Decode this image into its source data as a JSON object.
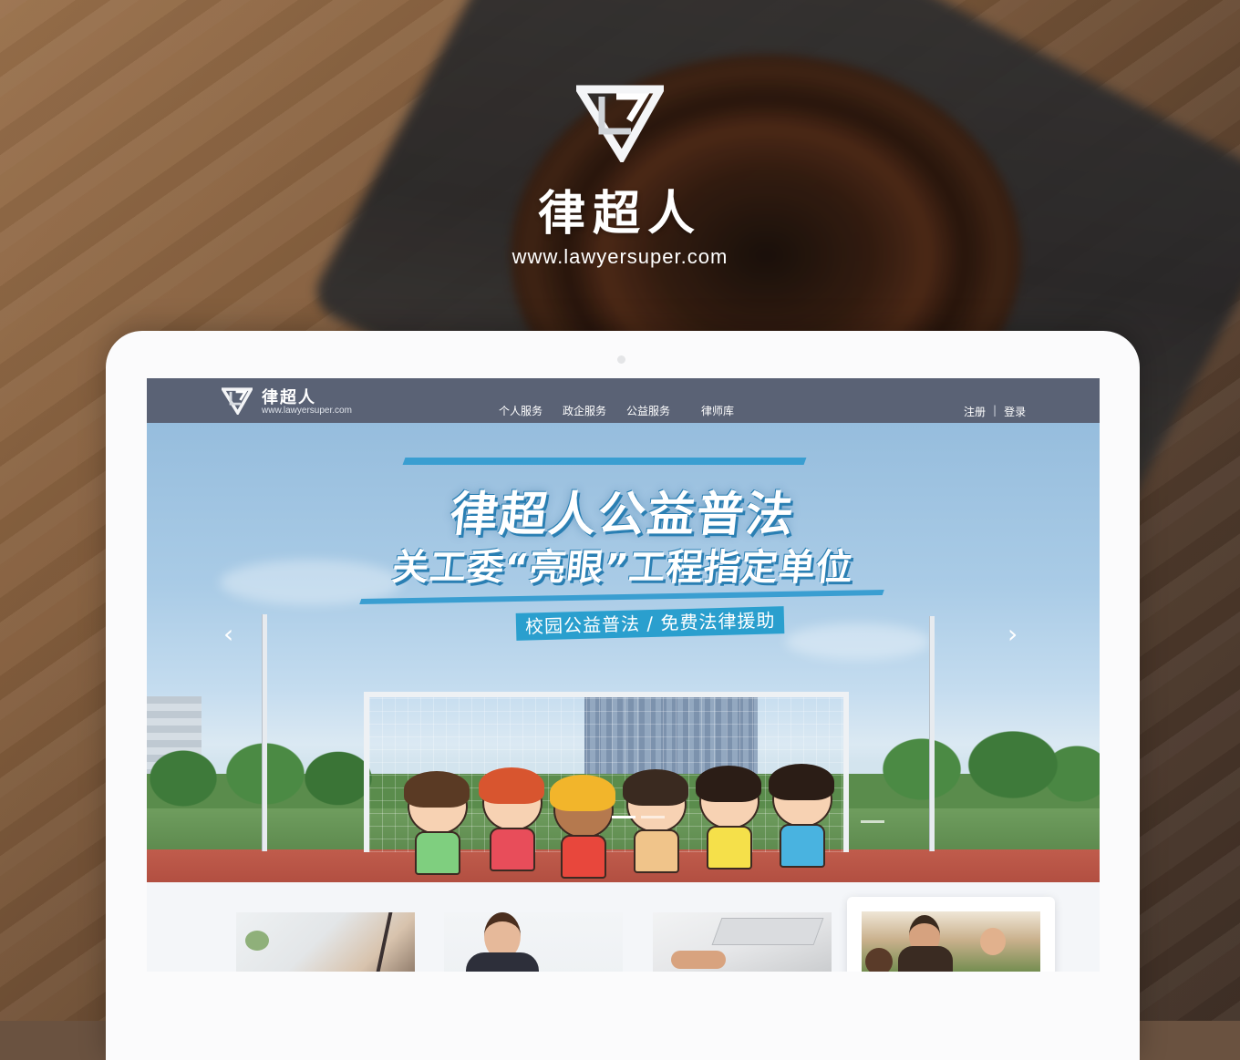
{
  "brand": {
    "name": "律超人",
    "url": "www.lawyersuper.com"
  },
  "nav": {
    "site_name": "律超人",
    "site_url": "www.lawyersuper.com",
    "menu": [
      "个人服务",
      "政企服务",
      "公益服务",
      "律师库"
    ],
    "register": "注册",
    "separator": "|",
    "login": "登录"
  },
  "banner": {
    "headline": "律超人公益普法",
    "subline": "关工委“亮眼”工程指定单位",
    "tagline": "校园公益普法 / 免费法律援助",
    "prev_icon": "chevron-left-icon",
    "next_icon": "chevron-right-icon"
  },
  "colors": {
    "nav_bg": "#5a6275",
    "accent": "#2a9fce",
    "device": "#fbfbfc"
  }
}
